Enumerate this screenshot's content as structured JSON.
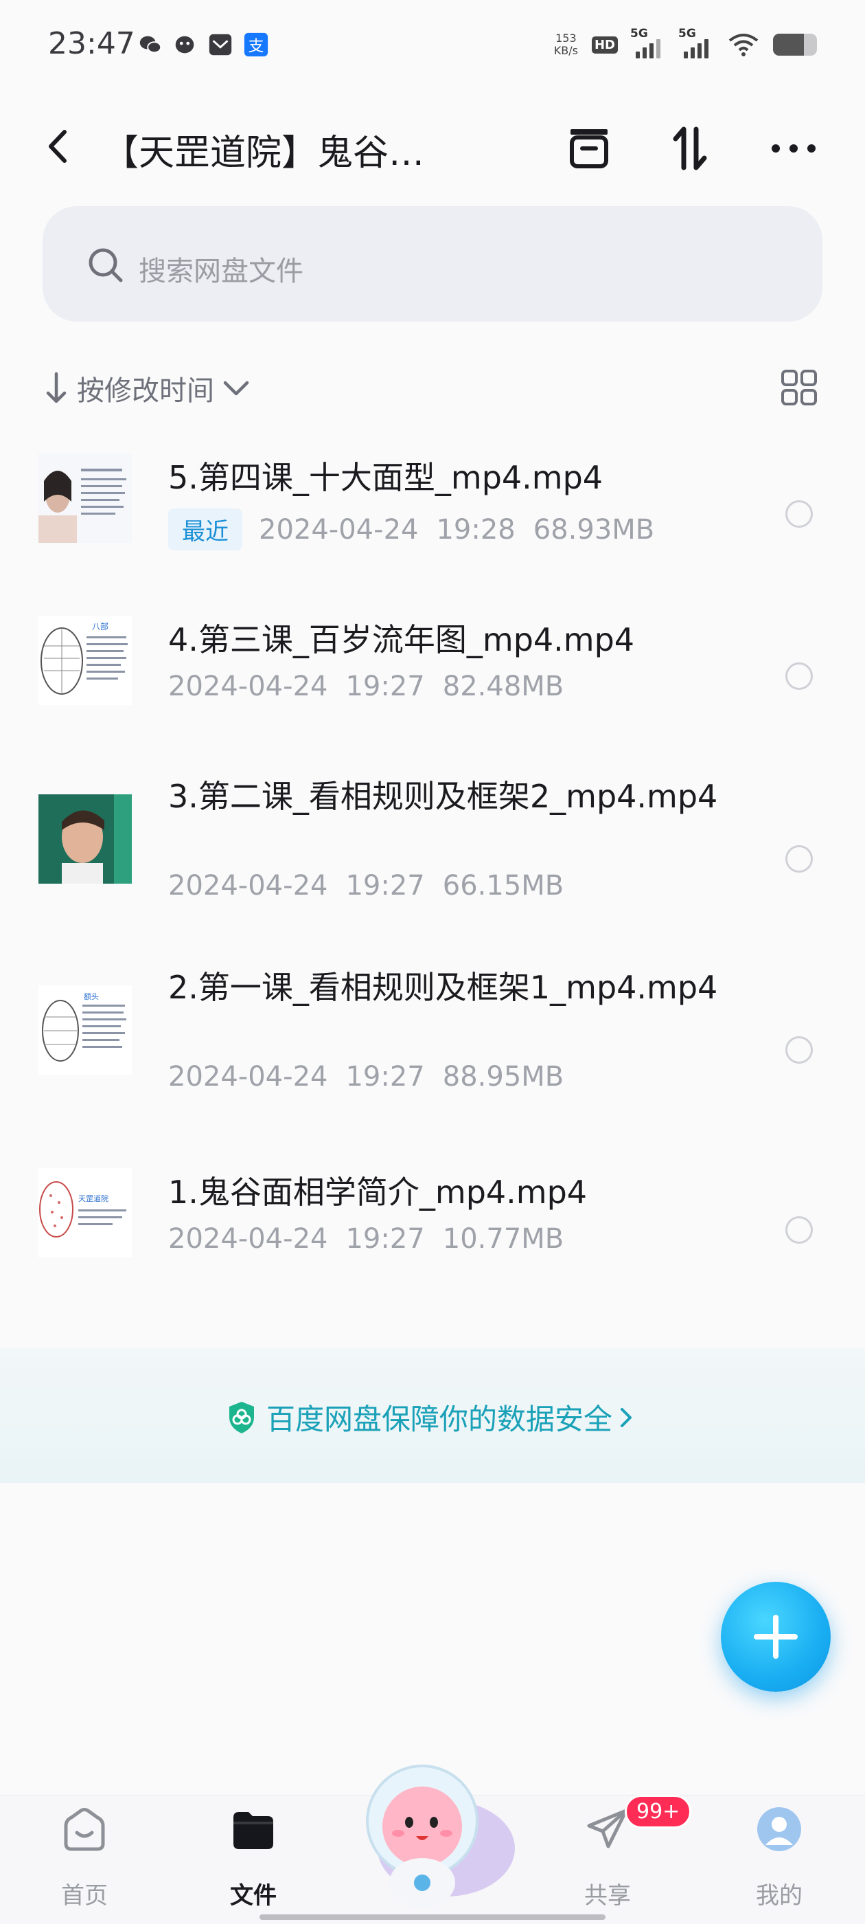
{
  "status_bar": {
    "time": "23:47",
    "network_speed_value": "153",
    "network_speed_unit": "KB/s",
    "hd_label": "HD",
    "sim1_label": "5G",
    "sim2_label": "5G",
    "battery_level": 0.7,
    "app_icons": [
      "wechat-icon",
      "qq-icon",
      "mail-icon",
      "alipay-icon"
    ]
  },
  "header": {
    "title": "【天罡道院】鬼谷…",
    "icons": [
      "back-icon",
      "archive-icon",
      "sort-transfer-icon",
      "more-icon"
    ]
  },
  "search": {
    "placeholder": "搜索网盘文件"
  },
  "sort": {
    "label": "按修改时间"
  },
  "files": [
    {
      "name": "5.第四课_十大面型_mp4.mp4",
      "badge": "最近",
      "date": "2024-04-24",
      "time": "19:28",
      "size": "68.93MB"
    },
    {
      "name": "4.第三课_百岁流年图_mp4.mp4",
      "date": "2024-04-24",
      "time": "19:27",
      "size": "82.48MB"
    },
    {
      "name": "3.第二课_看相规则及框架2_mp4.mp4",
      "date": "2024-04-24",
      "time": "19:27",
      "size": "66.15MB"
    },
    {
      "name": "2.第一课_看相规则及框架1_mp4.mp4",
      "date": "2024-04-24",
      "time": "19:27",
      "size": "88.95MB"
    },
    {
      "name": "1.鬼谷面相学简介_mp4.mp4",
      "date": "2024-04-24",
      "time": "19:27",
      "size": "10.77MB"
    }
  ],
  "banner": {
    "text": "百度网盘保障你的数据安全"
  },
  "nav": {
    "home": "首页",
    "files": "文件",
    "share": "共享",
    "mine": "我的",
    "share_badge": "99+"
  },
  "colors": {
    "accent": "#19aef2",
    "banner_text": "#1aa1b8",
    "badge_red": "#ff2d55",
    "recent_badge_bg": "#e8f3fb",
    "recent_badge_text": "#1a8fd6"
  }
}
